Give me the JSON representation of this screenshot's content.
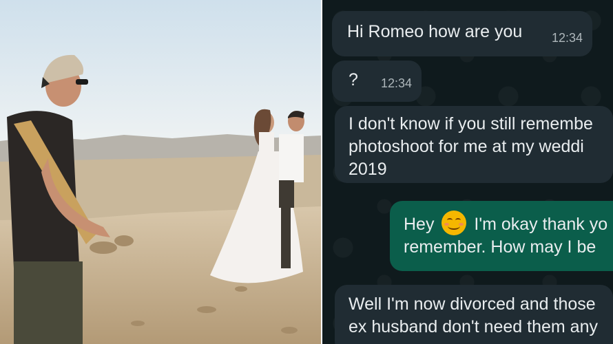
{
  "chat": {
    "messages": [
      {
        "direction": "incoming",
        "lines": [
          "Hi Romeo how are you"
        ],
        "time": "12:34"
      },
      {
        "direction": "incoming",
        "lines": [
          "?"
        ],
        "time": "12:34"
      },
      {
        "direction": "incoming",
        "lines": [
          "I don't know if you still remembe",
          "photoshoot for me at my weddi",
          "2019"
        ],
        "time": ""
      },
      {
        "direction": "outgoing",
        "line1_before": "Hey",
        "emoji": "smiling-face-emoji",
        "line1_after": "I'm okay thank yo",
        "line2": "remember. How may I be",
        "time": ""
      },
      {
        "direction": "incoming",
        "lines": [
          "Well I'm now divorced and those",
          "ex husband don't need them any"
        ],
        "time": ""
      }
    ]
  },
  "colors": {
    "chat_background": "#0f1a1d",
    "incoming_bubble": "#202c33",
    "outgoing_bubble": "#0b5e4b",
    "message_text": "#e9edef",
    "timestamp_text": "#aeb7bb"
  }
}
